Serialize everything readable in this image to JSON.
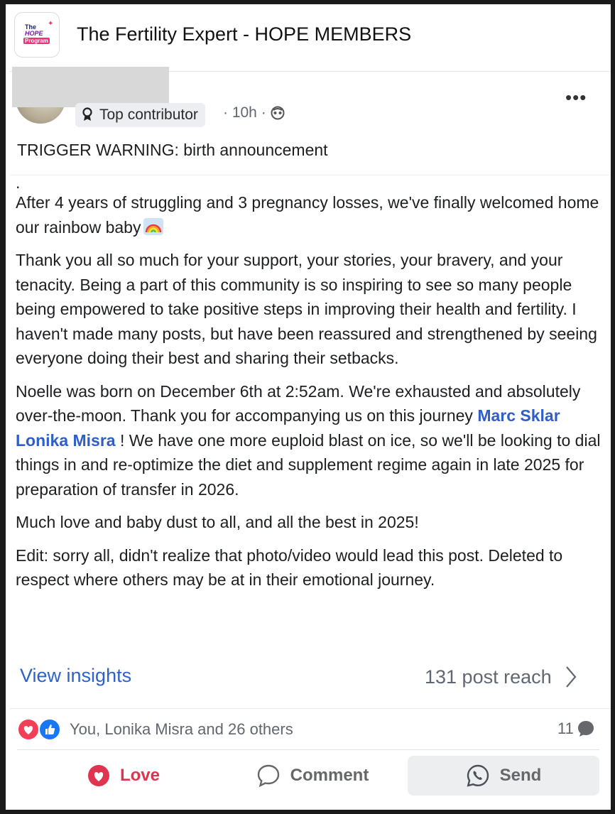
{
  "group": {
    "title": "The Fertility Expert - HOPE MEMBERS",
    "logo": {
      "line1": "The",
      "line2": "HOPE",
      "line3": "Program"
    }
  },
  "post": {
    "badge_label": "Top contributor",
    "time": "· 10h ·",
    "trigger": "TRIGGER WARNING: birth announcement",
    "dot": ".",
    "para1": "After 4 years of struggling and 3 pregnancy losses, we've finally welcomed home our rainbow baby",
    "para2": "Thank you all so much for your support, your stories, your bravery, and your tenacity. Being a part of this community is so inspiring to see so many people being empowered to take positive steps in improving their health and fertility. I haven't made many posts, but have been reassured and strengthened by seeing everyone doing their best and sharing their setbacks.",
    "para3_before": "Noelle was born on December 6th at 2:52am. We're exhausted and absolutely over-the-moon. Thank you for accompanying us on this journey ",
    "mention": "Marc Sklar Lonika Misra",
    "para3_after": " !  We have one more euploid blast on ice, so we'll be looking to dial things in and re-optimize the diet and supplement regime again in late 2025 for preparation of transfer in 2026.",
    "para4": "Much love and baby dust to all, and all the best in 2025!",
    "para5": "Edit: sorry all, didn't realize that photo/video would lead this post. Deleted to respect where others may be at in their emotional journey."
  },
  "insights": {
    "link": "View insights",
    "reach": "131 post reach"
  },
  "reactions": {
    "names": "You, Lonika Misra and 26 others",
    "comment_count": "11"
  },
  "actions": {
    "love": "Love",
    "comment": "Comment",
    "send": "Send"
  },
  "colors": {
    "accent": "#2f5fc6",
    "love": "#e0334f",
    "like": "#1877f2"
  }
}
